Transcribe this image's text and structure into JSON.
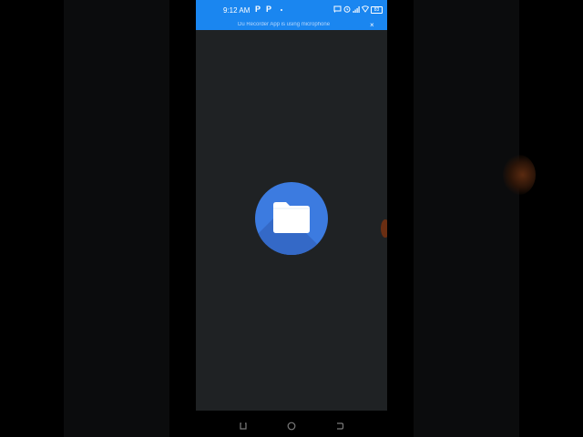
{
  "status_bar": {
    "time": "9:12 AM",
    "notif_icon_1": "P",
    "notif_icon_2": "P",
    "icons": [
      "cast-icon",
      "alarm-icon",
      "signal-icon",
      "wifi-icon",
      "battery-icon"
    ],
    "battery_label": "83",
    "background": "#1a86f0"
  },
  "notification": {
    "text": "Du Recorder App is using microphone",
    "close_label": "×"
  },
  "app": {
    "icon_name": "files-folder-icon",
    "icon_color": "#3c7be0",
    "screen_background": "#1f2224"
  },
  "nav_bar": {
    "buttons": [
      "recent-apps-icon",
      "home-icon",
      "back-icon"
    ]
  }
}
